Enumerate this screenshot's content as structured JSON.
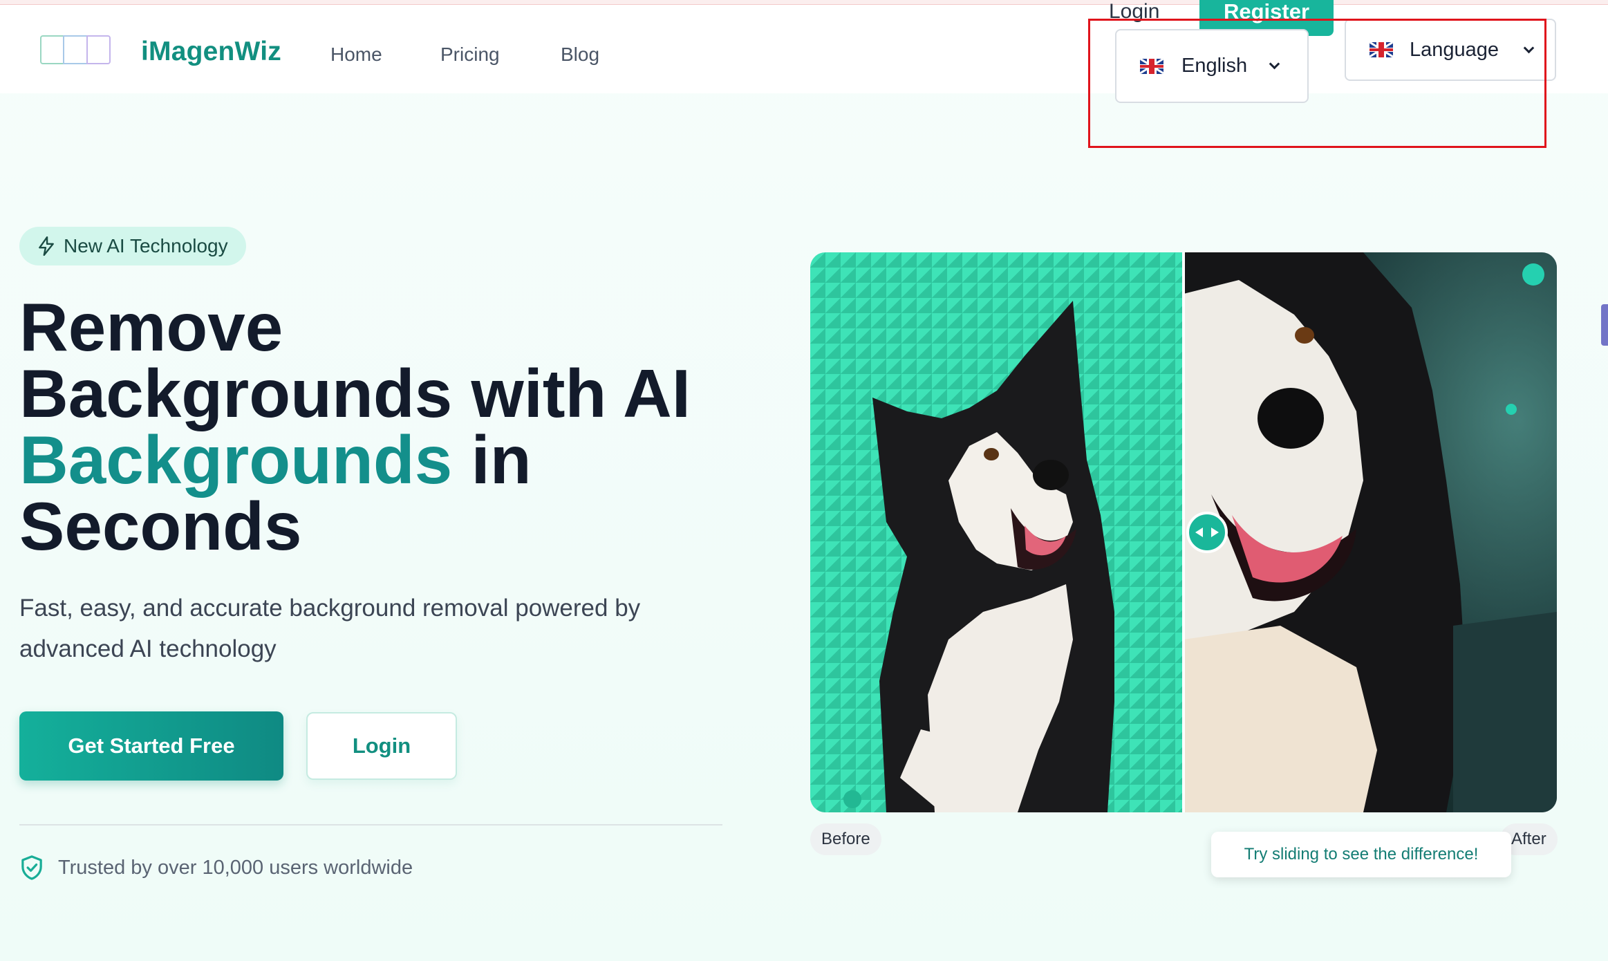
{
  "header": {
    "brand": "iMagenWiz",
    "nav": [
      "Home",
      "Pricing",
      "Blog"
    ],
    "top_login": "Login",
    "top_register": "Register",
    "language_select_1": "English",
    "language_select_2": "Language"
  },
  "hero": {
    "badge": "New AI Technology",
    "headline_line1": "Remove",
    "headline_line2": "Backgrounds with AI",
    "headline_accent": "Backgrounds",
    "headline_in": " in",
    "headline_line4": "Seconds",
    "subtitle": "Fast, easy, and accurate background removal powered by advanced AI technology",
    "primary_button": "Get Started Free",
    "secondary_button": "Login",
    "trust_text": "Trusted by over 10,000 users worldwide"
  },
  "compare": {
    "before_label": "Before",
    "after_label": "After",
    "hint": "Try sliding to see the difference!"
  },
  "colors": {
    "accent": "#128f80",
    "primary_button": "#14b09b",
    "before_bg": "#3ee3b7",
    "highlight_box": "#e0141c"
  },
  "icons": [
    "logo-icon",
    "flag-uk-icon",
    "chevron-down-icon",
    "lightning-icon",
    "shield-check-icon",
    "slider-arrows-icon"
  ]
}
